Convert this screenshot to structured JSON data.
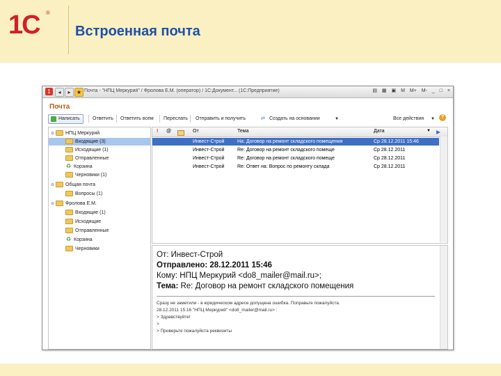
{
  "slide": {
    "logo": "1С",
    "logo_mark": "®",
    "title": "Встроенная почта"
  },
  "window": {
    "title": "Почта - \"НПЦ Меркурий\" / Фролова Е.М. (оператор) / 1С:Документ... (1С:Предприятие)",
    "controls": [
      "M",
      "M+",
      "M-",
      "_",
      "□",
      "×"
    ]
  },
  "pane_title": "Почта",
  "toolbar": {
    "create": "Написать",
    "reply": "Ответить",
    "reply_all": "Ответить всем",
    "forward": "Переслать",
    "send_receive": "Отправить и получить",
    "create_based": "Создать на основании",
    "all_actions": "Все действия"
  },
  "tree": [
    {
      "label": "НПЦ Меркурий",
      "level": 0,
      "kind": "root",
      "expanded": true
    },
    {
      "label": "Входящие (3)",
      "level": 1,
      "kind": "folder",
      "selected": true
    },
    {
      "label": "Исходящие (1)",
      "level": 1,
      "kind": "folder"
    },
    {
      "label": "Отправленные",
      "level": 1,
      "kind": "folder"
    },
    {
      "label": "Корзина",
      "level": 1,
      "kind": "trash"
    },
    {
      "label": "Черновики (1)",
      "level": 1,
      "kind": "folder"
    },
    {
      "label": "Общая почта",
      "level": 0,
      "kind": "root",
      "expanded": true
    },
    {
      "label": "Вопросы (1)",
      "level": 1,
      "kind": "folder"
    },
    {
      "label": "Фролова Е.М.",
      "level": 0,
      "kind": "root",
      "expanded": true
    },
    {
      "label": "Входящие (1)",
      "level": 1,
      "kind": "folder"
    },
    {
      "label": "Исходящие",
      "level": 1,
      "kind": "folder"
    },
    {
      "label": "Отправленные",
      "level": 1,
      "kind": "folder"
    },
    {
      "label": "Корзина",
      "level": 1,
      "kind": "trash"
    },
    {
      "label": "Черновики",
      "level": 1,
      "kind": "folder"
    }
  ],
  "list": {
    "columns": {
      "importance": "!",
      "attach": "@",
      "from": "От",
      "subject": "Тема",
      "date": "Дата"
    },
    "rows": [
      {
        "from": "Инвест-Строй",
        "subject": "На: Договор на ремонт складского помещения",
        "date": "Ср 28.12.2011 15:46",
        "flag": "",
        "selected": true
      },
      {
        "from": "Инвест-Строй",
        "subject": "Re: Договор на ремонт складского помеще",
        "date": "Ср 28.12.2011",
        "flag": "red",
        "selected": false
      },
      {
        "from": "Инвест-Строй",
        "subject": "Re: Договор на ремонт складского помеще",
        "date": "Ср 28.12.2011",
        "flag": "blue",
        "selected": false
      },
      {
        "from": "Инвест-Строй",
        "subject": "Re: Ответ на: Вопрос по ремонту склада",
        "date": "Ср 28.12.2011",
        "flag": "",
        "selected": false
      }
    ]
  },
  "preview": {
    "from": "От: Инвест-Строй",
    "sent": "Отправлено: 28.12.2011 15:46",
    "to": "Кому: НПЦ Меркурий <do8_mailer@mail.ru>;",
    "subject_label": "Тема:",
    "subject": "Re: Договор на ремонт складского помещения",
    "body": [
      "Сразу не заметили - в юридическом адресе допущена ошибка. Поправьте пожалуйста.",
      "28.12.2011 15:16 \"НПЦ Меркурий\" <do8_mailer@mail.ru> :",
      "> Здравствуйте!",
      ">",
      "> Проверьте пожалуйста реквизиты"
    ]
  }
}
